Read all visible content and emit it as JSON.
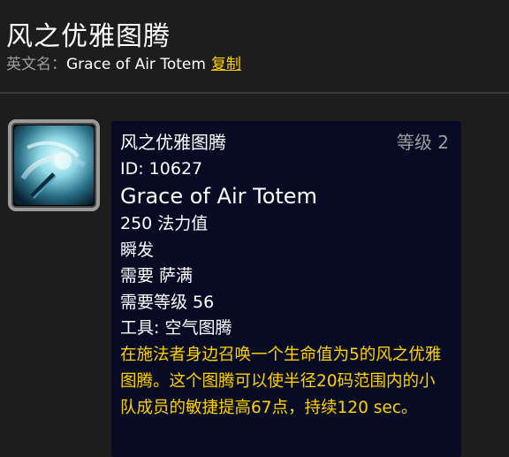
{
  "page": {
    "title": "风之优雅图腾",
    "english_label": "英文名：",
    "english_name": "Grace of Air Totem",
    "copy_link": "复制"
  },
  "tooltip": {
    "name": "风之优雅图腾",
    "level": "等级 2",
    "id_line": "ID: 10627",
    "english_name": "Grace of Air Totem",
    "cost": "250 法力值",
    "cast": "瞬发",
    "requires_class": "需要 萨满",
    "requires_level": "需要等级 56",
    "tool": "工具: 空气图腾",
    "description": "在施法者身边召唤一个生命值为5的风之优雅图腾。这个图腾可以使半径20码范围内的小队成员的敏捷提高67点，持续120 sec。"
  },
  "colors": {
    "background": "#1d1d1d",
    "tooltip_bg": "#070b24",
    "gold": "#ffd100",
    "gray_text": "#9d9d9d"
  },
  "icons": {
    "spell_icon": "grace-of-air-totem-icon"
  }
}
